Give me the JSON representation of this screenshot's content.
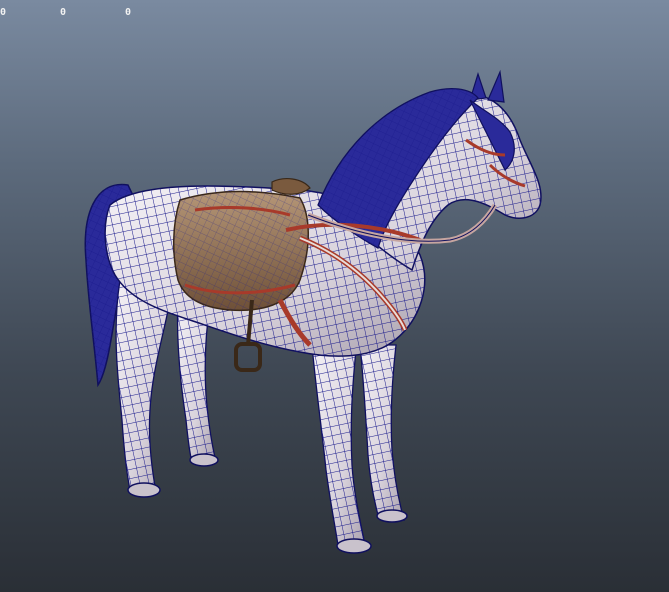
{
  "viewport": {
    "hud": {
      "stats": [
        "0",
        "0",
        "0"
      ]
    },
    "model": {
      "name_icon": "horse-wireframe-model",
      "wire_color": "#1a1a8c",
      "body_color": "#e7e3ea",
      "saddle_color": "#8c6a4a",
      "trim_color": "#a83a2a"
    },
    "colors": {
      "background_top": "#7a8aa0",
      "background_bottom": "#2a2f36"
    }
  }
}
